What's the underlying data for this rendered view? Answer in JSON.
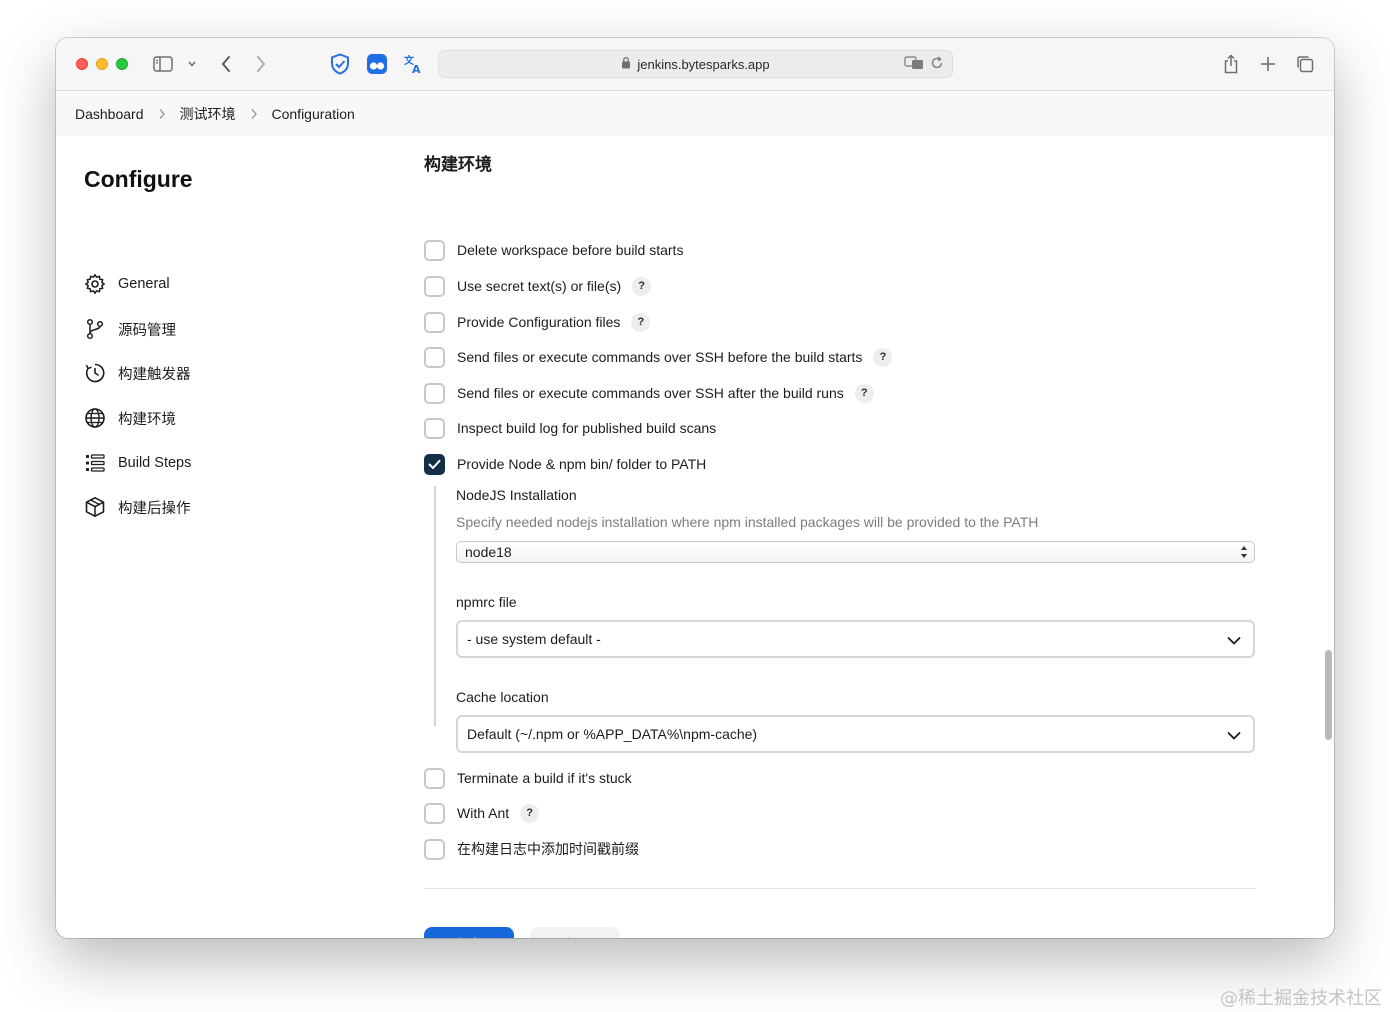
{
  "browser": {
    "url": "jenkins.bytesparks.app"
  },
  "breadcrumb": [
    "Dashboard",
    "测试环境",
    "Configuration"
  ],
  "sidebar": {
    "title": "Configure",
    "items": [
      {
        "label": "General",
        "icon": "gear-icon"
      },
      {
        "label": "源码管理",
        "icon": "branch-icon"
      },
      {
        "label": "构建触发器",
        "icon": "clock-icon"
      },
      {
        "label": "构建环境",
        "icon": "globe-icon"
      },
      {
        "label": "Build Steps",
        "icon": "list-icon"
      },
      {
        "label": "构建后操作",
        "icon": "package-icon"
      }
    ]
  },
  "main": {
    "section_title": "构建环境",
    "options": [
      {
        "label": "Delete workspace before build starts",
        "checked": false,
        "help": false
      },
      {
        "label": "Use secret text(s) or file(s)",
        "checked": false,
        "help": true
      },
      {
        "label": "Provide Configuration files",
        "checked": false,
        "help": true
      },
      {
        "label": "Send files or execute commands over SSH before the build starts",
        "checked": false,
        "help": true
      },
      {
        "label": "Send files or execute commands over SSH after the build runs",
        "checked": false,
        "help": true
      },
      {
        "label": "Inspect build log for published build scans",
        "checked": false,
        "help": false
      },
      {
        "label": "Provide Node & npm bin/ folder to PATH",
        "checked": true,
        "help": false
      }
    ],
    "nodejs": {
      "label": "NodeJS Installation",
      "description": "Specify needed nodejs installation where npm installed packages will be provided to the PATH",
      "value": "node18"
    },
    "npmrc": {
      "label": "npmrc file",
      "value": "- use system default -"
    },
    "cache": {
      "label": "Cache location",
      "value": "Default (~/.npm or %APP_DATA%\\npm-cache)"
    },
    "options_after": [
      {
        "label": "Terminate a build if it's stuck",
        "checked": false,
        "help": false
      },
      {
        "label": "With Ant",
        "checked": false,
        "help": true
      },
      {
        "label": "在构建日志中添加时间戳前缀",
        "checked": false,
        "help": false
      }
    ],
    "help_glyph": "?",
    "save_label": "保存",
    "apply_label": "应用"
  },
  "watermark": "@稀土掘金技术社区",
  "colors": {
    "accent": "#1668dc",
    "checkbox_checked": "#152e47"
  }
}
